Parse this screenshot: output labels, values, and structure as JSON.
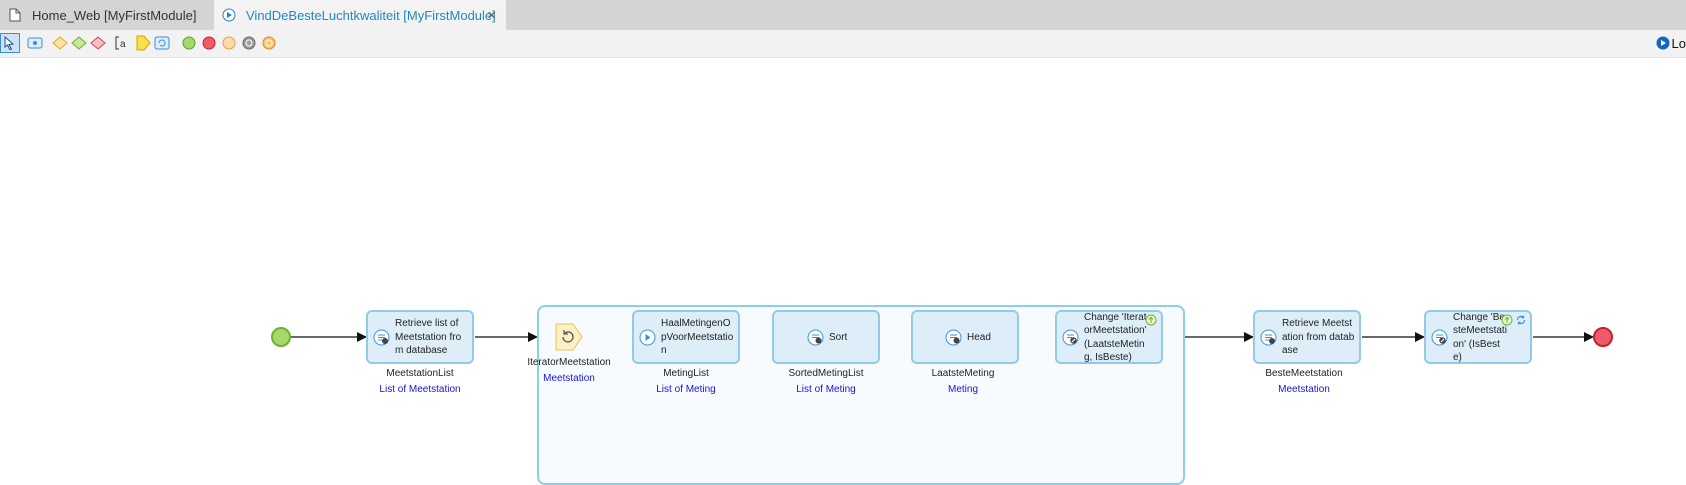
{
  "tabs": [
    {
      "label": "Home_Web [MyFirstModule]",
      "icon": "document-icon"
    },
    {
      "label": "VindDeBesteLuchtkwaliteit [MyFirstModule]",
      "icon": "microflow-icon",
      "close": "×"
    }
  ],
  "toolbar": {
    "tools": [
      "pointer-tool",
      "activity-tool",
      "decision-tool",
      "object-type-decision-tool",
      "merge-tool",
      "annotation-tool",
      "parameter-tool",
      "loop-tool",
      "start-event-tool",
      "end-event-tool",
      "error-event-tool",
      "continue-event-tool",
      "break-event-tool"
    ],
    "right_label": "Lo"
  },
  "colors": {
    "accent": "#1e88c8",
    "activity_fill": "#ddeef9",
    "activity_border": "#93cbe6",
    "start": "#a5d86a",
    "end": "#ef5b6a",
    "type_link": "#1515d8"
  },
  "flow": {
    "start": "start-event",
    "activities": [
      {
        "id": "a1",
        "text": "Retrieve list of Meetstation from database",
        "variable": "MeetstationList",
        "type": "List of Meetstation",
        "icon": "retrieve-icon"
      },
      {
        "id": "a2",
        "text": "HaalMetingenOpVoorMeetstation",
        "variable": "MetingList",
        "type": "List of Meting",
        "icon": "microflow-call-icon"
      },
      {
        "id": "a3",
        "text": "Sort",
        "variable": "SortedMetingList",
        "type": "List of Meting",
        "icon": "list-operation-icon"
      },
      {
        "id": "a4",
        "text": "Head",
        "variable": "LaatsteMeting",
        "type": "Meting",
        "icon": "list-operation-icon"
      },
      {
        "id": "a5",
        "text": "Change 'IteratorMeetstation' (LaatsteMeting, IsBeste)",
        "variable": "",
        "type": "",
        "icon": "change-object-icon"
      },
      {
        "id": "a6",
        "text": "Retrieve Meetstation from database",
        "variable": "BesteMeetstation",
        "type": "Meetstation",
        "icon": "retrieve-icon"
      },
      {
        "id": "a7",
        "text": "Change 'BesteMeetstation' (IsBeste)",
        "variable": "",
        "type": "",
        "icon": "change-object-icon"
      }
    ],
    "loop": {
      "iterator": "IteratorMeetstation",
      "type": "Meetstation"
    },
    "end": "end-event"
  }
}
